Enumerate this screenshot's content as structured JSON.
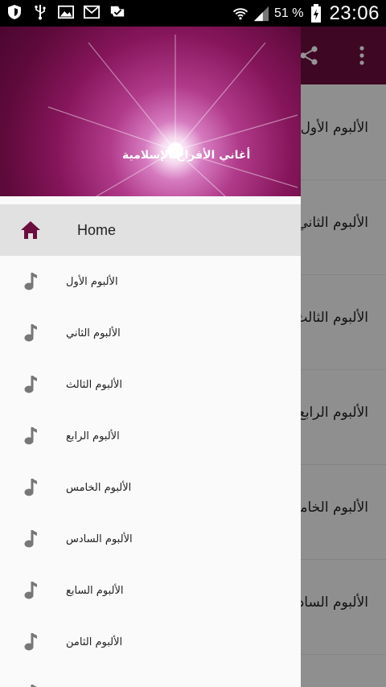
{
  "statusbar": {
    "battery_text": "51 %",
    "time": "23:06",
    "icons": [
      "shield-icon",
      "usb-icon",
      "image-icon",
      "mail-icon",
      "check-flag-icon",
      "wifi-icon",
      "signal-icon",
      "battery-icon"
    ]
  },
  "appbar": {
    "color": "#6b0d3f",
    "actions": [
      "share-icon",
      "more-vertical-icon"
    ]
  },
  "background_list": {
    "items": [
      {
        "label": "الألبوم الأول"
      },
      {
        "label": "الألبوم الثاني"
      },
      {
        "label": "الألبوم الثالث"
      },
      {
        "label": "الألبوم الرابع"
      },
      {
        "label": "الألبوم الخامس"
      },
      {
        "label": "الألبوم السادس"
      }
    ]
  },
  "drawer": {
    "header_title": "أغاني الأفراح الإسلامية",
    "accent": "#6b0d3f",
    "items": [
      {
        "label": "Home",
        "icon": "home-icon",
        "active": true
      },
      {
        "label": "الألبوم الأول",
        "icon": "music-note-icon"
      },
      {
        "label": "الألبوم الثاني",
        "icon": "music-note-icon"
      },
      {
        "label": "الألبوم الثالث",
        "icon": "music-note-icon"
      },
      {
        "label": "الألبوم الرابع",
        "icon": "music-note-icon"
      },
      {
        "label": "الألبوم الخامس",
        "icon": "music-note-icon"
      },
      {
        "label": "الألبوم السادس",
        "icon": "music-note-icon"
      },
      {
        "label": "الألبوم السابع",
        "icon": "music-note-icon"
      },
      {
        "label": "الألبوم الثامن",
        "icon": "music-note-icon"
      }
    ]
  }
}
